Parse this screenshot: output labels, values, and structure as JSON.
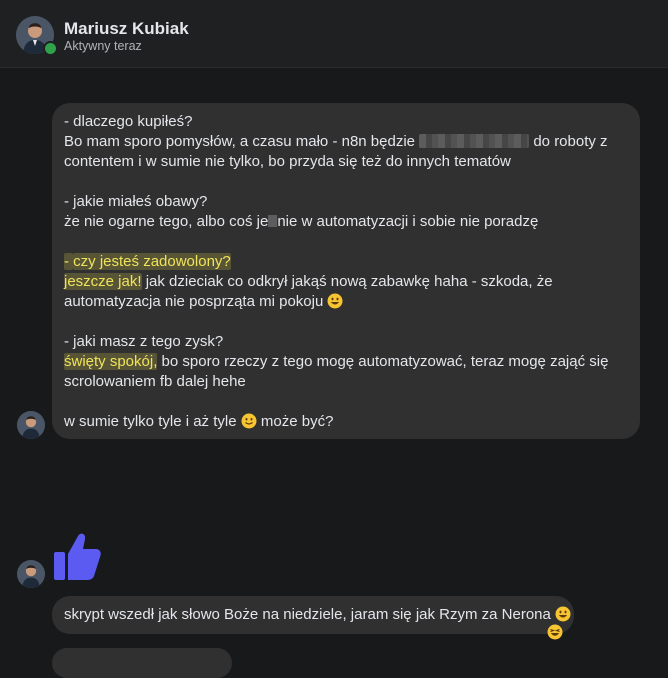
{
  "header": {
    "name": "Mariusz Kubiak",
    "status": "Aktywny teraz"
  },
  "message1": {
    "l1": "- dlaczego kupiłeś?",
    "l2a": "Bo mam sporo pomysłów, a czasu mało - n8n będzie ",
    "l2b": " do roboty z",
    "l3": "contentem i w sumie nie tylko, bo przyda się też do innych tematów",
    "l4": "- jakie miałeś obawy?",
    "l5a": "że nie ogarne tego, albo coś je",
    "l5b": "nie w automatyzacji i sobie nie poradzę",
    "l6a": "- ",
    "l6b": "czy jesteś zadowolony?",
    "l7a": "jeszcze jak!",
    "l7b": " jak dzieciak co odkrył jakąś nową zabawkę haha - szkoda, że",
    "l8": "automatyzacja nie posprząta mi pokoju ",
    "l9": "- jaki masz z tego zysk?",
    "l10a": "święty spokój,",
    "l10b": " bo sporo rzeczy z tego mogę automatyzować, teraz mogę zająć się",
    "l11": "scrolowaniem fb dalej hehe",
    "l12a": "w sumie tylko tyle i aż tyle ",
    "l12b": " może być?"
  },
  "message2": {
    "text": "skrypt wszedł jak słowo Boże na niedziele, jaram się jak Rzym za Nerona "
  },
  "icons": {
    "like": "thumbs-up-icon",
    "emoji_grin": "grinning-face-icon",
    "emoji_smile": "slightly-smiling-face-icon",
    "emoji_laugh": "laughing-face-icon"
  },
  "colors": {
    "background": "#18191a",
    "bubble": "#303030",
    "highlight_text": "#f0e35a",
    "like": "#5b5bf2",
    "online": "#31a24c"
  }
}
